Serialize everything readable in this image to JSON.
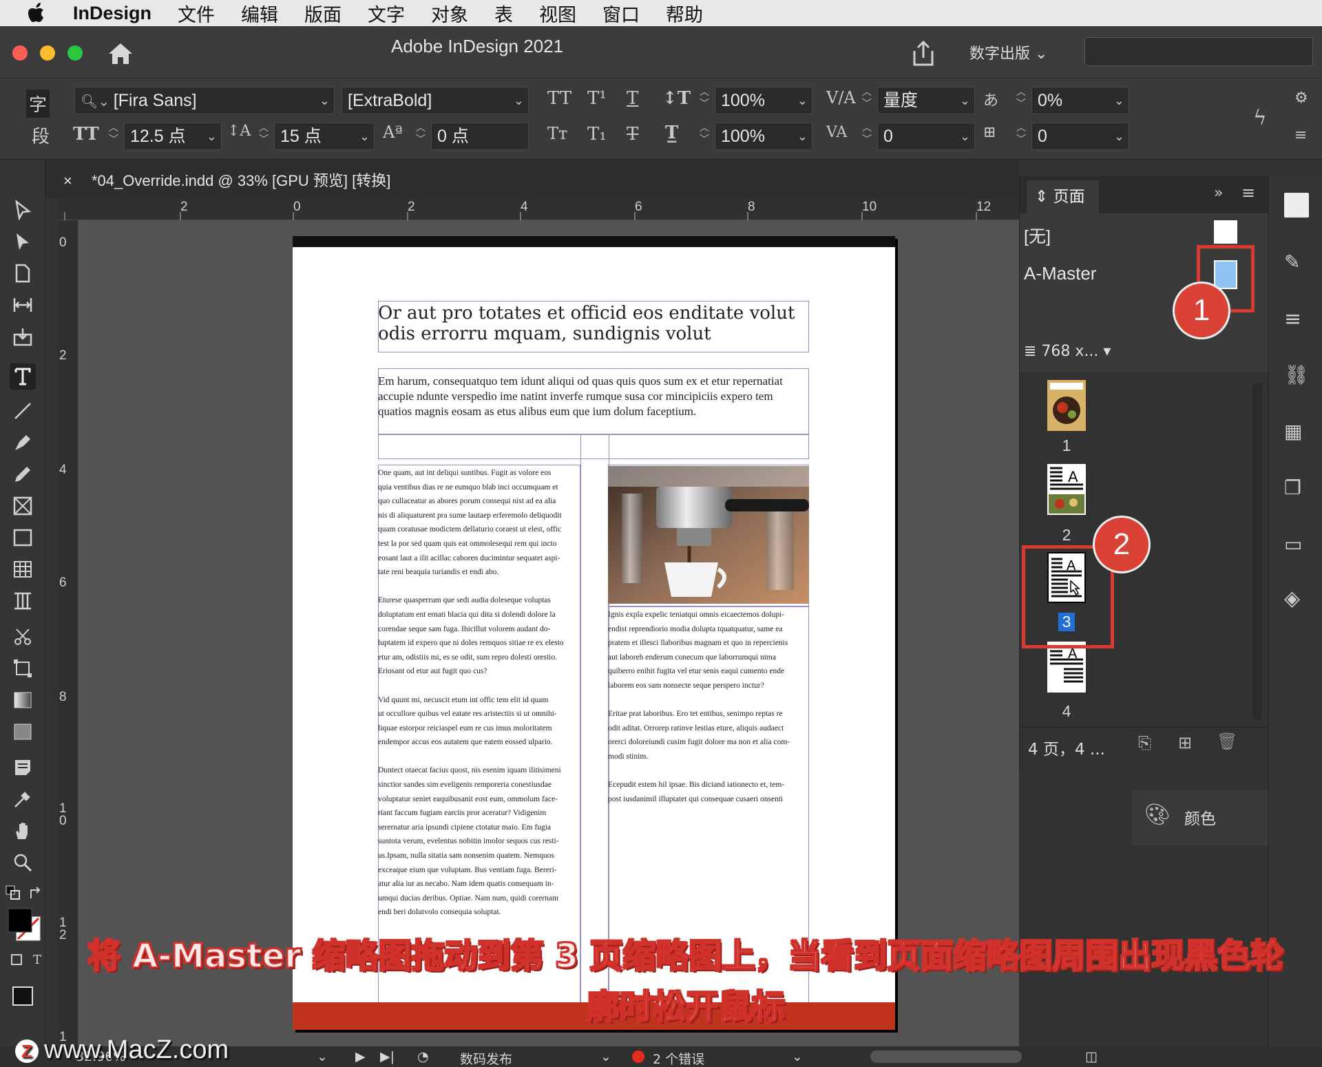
{
  "menubar": {
    "app_name": "InDesign",
    "items": [
      "文件",
      "编辑",
      "版面",
      "文字",
      "对象",
      "表",
      "视图",
      "窗口",
      "帮助"
    ]
  },
  "titlebar": {
    "title": "Adobe InDesign 2021",
    "workspace": "数字出版"
  },
  "control_panel": {
    "char_icon": "字",
    "para_icon": "段",
    "font_family": "[Fira Sans]",
    "font_style": "[ExtraBold]",
    "font_size": "12.5 点",
    "leading": "15 点",
    "baseline_shift": "0 点",
    "vertical_scale": "100%",
    "horizontal_scale": "100%",
    "kerning": "量度",
    "tracking": "0",
    "skew": "0%",
    "skew2": "0"
  },
  "document_tab": {
    "close": "×",
    "label": "*04_Override.indd @ 33% [GPU 预览] [转换]"
  },
  "rulers": {
    "horizontal": [
      "2",
      "0",
      "2",
      "4",
      "6",
      "8",
      "10",
      "12"
    ],
    "vertical": [
      "0",
      "2",
      "4",
      "6",
      "8",
      "1\n0",
      "1\n2",
      "1"
    ]
  },
  "document": {
    "headline": "Or aut pro totates et officid eos enditate volut odis errorru mquam, sundignis volut",
    "deck": "Em harum, consequatquo tem idunt aliqui od quas quis quos sum ex et etur repernatiat accupie ndunte verspedio ime natint inverfe rumque susa cor mincipiciis expero tem quatios magnis eosam as etus alibus eum que ium dolum faceptium.",
    "col_left": "One quam, aut int deliqui suntibus. Fugit as volore eos\nquia ventibus dias re ne eumquo blab inci occumquam et\nquo cullaceatur as abores porum consequi nist ad ea alia\nnis di aliquaturent pra sume lautaep erferemolo deliquodit\nquam coratusae modictem dellaturio coraest ut elest, offic\ntest la por sed quam quis eat ommolesequi rem qui incto\neosant laut a ilit acillac caboren ducimintur sequatet aspi-\ntate reni beaquia turiandis et endi abo.\n\nEturese quasperrum que sedi audia doleseque voluptas\ndoluptatum ent ernati blacia qui dita si dolendi dolore la\ncorendae seque sam fuga. Ihicillut volorem audant do-\nluptatem id expero que ni doles remquos sitiae re ex elesto\netur am, odistiis mi, es se odit, sum repro dolesti orestio.\nEriosant od etur aut fugit quo cus?\n\nVid quunt mi, necuscit etum int offic tem elit id quam\nut occullore quibus vel eatate res aristectiis si ut omnihi-\nliquae estorpor reiciaspel eum re cus imus moloritatem\nendempor accus eos autatem que eatem eossed ulpario.\n\nDuntect otaecat facius quost, nis esenim iquam ilitisimeni\nsinctior sandes sim eveligenis remporeria conestiusdae\nvoluptatur seniet eaquibusanit eost eum, ommolum face-\nriant faccum fugiam earciis pror aceratur? Vidigenim\nserernatur aria ipsundi cipiene ctotatur maio. Em fugia\nsuntota verum, evelentus nobitin imolor sequos cus resti-\nus.Ipsam, nulla sitatia sam nonsenim quatem. Nemquos\nexceaque eium que voluptam. Bus ventiam fuga. Bereri-\natur alia iur as necabo. Nam idem quatis consequam in-\numqui ducias deribus. Optiae. Nam num, quidi corernam\nendi beri dolutvolo consequia soluptat.",
    "col_right": "Ignis expla expelic teniatqui omnis eicaectemos dolupi-\nendist reprendiorio modia dolupta tquatquatur, same ea\npratem et illesci llaboribus magnam et quo in repercienis\naut laboreh enderum conecum que laborrumqui nima\nquiberro enihit fugita vel etur senis eaqui cumento ende\nlaborem eos sam nonsecte seque perspero inctur?\n\nEritae prat laboribus. Ero tet entibus, senimpo reptas re\nodit aditat. Orrorep ratinve lestias eture, aliquis audaect\norerci doloreiundi cusim fugit dolore ma non et alia com-\nmodi stinim.\n\nEcepudit estem hil ipsae. Bis diciand iationecto et, tem-\npost iusdanimil illuptatet qui consequae cusaeri onsenti"
  },
  "pages_panel": {
    "tab_label": "页面",
    "none_label": "[无]",
    "master_label": "A-Master",
    "size_label": "768 x...",
    "pages": [
      "1",
      "2",
      "3",
      "4"
    ],
    "selected_page": "3",
    "footer": "4 页，4 ..."
  },
  "annotations": {
    "badge_1": "1",
    "badge_2": "2",
    "caption": "将 A-Master 缩略图拖动到第 3 页缩略图上，当看到页面缩略图周围出现黑色轮廓时松开鼠标"
  },
  "color_panel": {
    "label": "颜色"
  },
  "statusbar": {
    "zoom": "32.96%",
    "preflight_profile": "数码发布",
    "errors": "2 个错误"
  },
  "watermark": "www.MacZ.com",
  "colors": {
    "accent_red": "#d93a30",
    "page_bottom_bar": "#c0341d",
    "selected_blue": "#1f6fd6",
    "master_blue": "#8fc3f2"
  },
  "icons": [
    "apple-icon",
    "home-icon",
    "share-icon",
    "search-icon",
    "gear-icon",
    "lightning-icon",
    "selection-tool-icon",
    "direct-selection-tool-icon",
    "type-tool-icon",
    "zoom-tool-icon",
    "hand-tool-icon",
    "palette-icon",
    "trash-icon"
  ]
}
